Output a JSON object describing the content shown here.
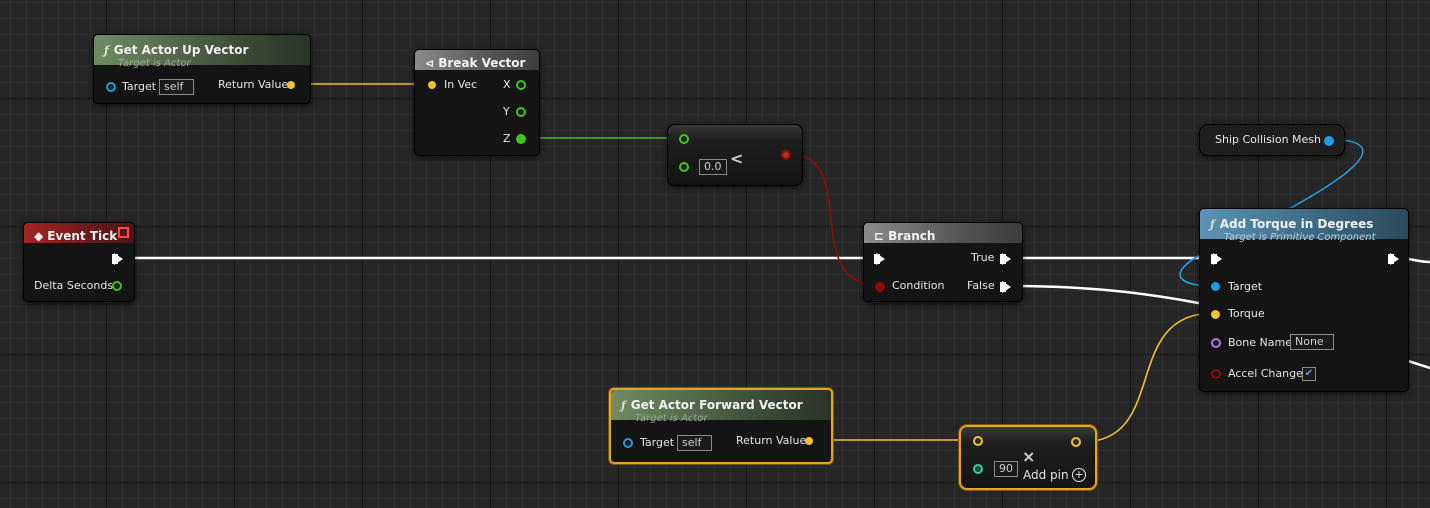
{
  "nodes": {
    "get_up": {
      "title": "Get Actor Up Vector",
      "subtitle": "Target is Actor",
      "target_label": "Target",
      "target_value": "self",
      "return_label": "Return Value"
    },
    "break_vector": {
      "title": "Break Vector",
      "in_label": "In Vec",
      "x_label": "X",
      "y_label": "Y",
      "z_label": "Z"
    },
    "less": {
      "operator": "<",
      "value": "0.0"
    },
    "event_tick": {
      "title": "Event Tick",
      "delta_label": "Delta Seconds"
    },
    "branch": {
      "title": "Branch",
      "true_label": "True",
      "false_label": "False",
      "condition_label": "Condition"
    },
    "ship_mesh": {
      "label": "Ship Collision Mesh"
    },
    "add_torque": {
      "title": "Add Torque in Degrees",
      "subtitle": "Target is Primitive Component",
      "target_label": "Target",
      "torque_label": "Torque",
      "bone_label": "Bone Name",
      "bone_value": "None",
      "accel_label": "Accel Change",
      "accel_checked": true
    },
    "get_forward": {
      "title": "Get Actor Forward Vector",
      "subtitle": "Target is Actor",
      "target_label": "Target",
      "target_value": "self",
      "return_label": "Return Value"
    },
    "multiply": {
      "operator": "×",
      "value": "90",
      "add_pin_label": "Add pin"
    }
  },
  "colors": {
    "vector": "#f2c230",
    "float": "#43c41c",
    "bool": "#8e0a0a",
    "object": "#1f9ce6",
    "name": "#b07ae0",
    "exec": "#ffffff",
    "selection": "#e3a523",
    "grid_bg": "#262626"
  },
  "icons": {
    "function": "function-icon",
    "break": "break-icon",
    "event": "event-icon",
    "branch": "branch-icon",
    "delegate": "delegate-square-icon",
    "add_pin": "add-pin-icon"
  }
}
